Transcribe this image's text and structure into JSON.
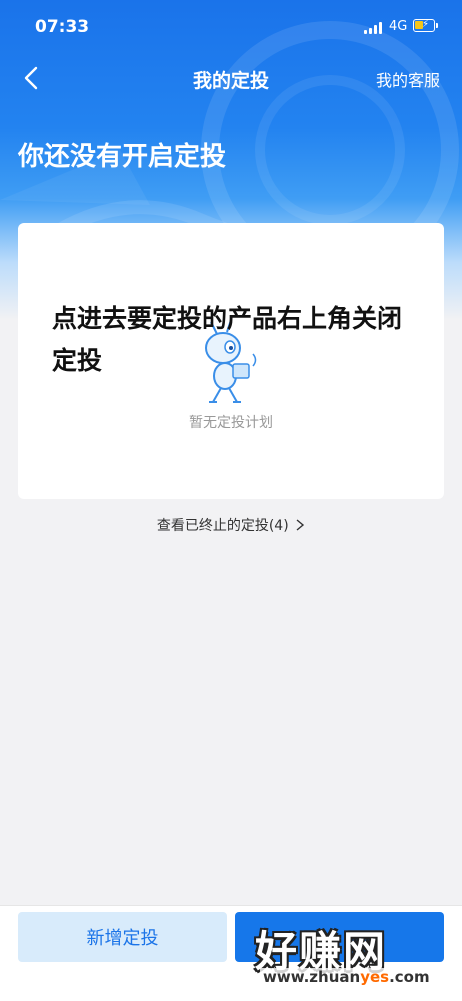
{
  "status_bar": {
    "time": "07:33",
    "network": "4G"
  },
  "nav": {
    "title": "我的定投",
    "right_link": "我的客服"
  },
  "hero": {
    "title": "你还没有开启定投"
  },
  "empty_state": {
    "text": "暂无定投计划",
    "mascot_icon": "ant-mascot-icon"
  },
  "overlay_note": "点进去要定投的产品右上角关闭定投",
  "history_link": "查看已终止的定投(4)",
  "buttons": {
    "add": "新增定投",
    "primary": ""
  },
  "watermark": {
    "main": "好赚网",
    "url_prefix": "www.zhuan",
    "url_highlight": "yes",
    "url_suffix": ".com"
  },
  "colors": {
    "primary": "#1677ea",
    "secondary_bg": "#d8ebfb",
    "page_bg": "#f2f2f4"
  }
}
